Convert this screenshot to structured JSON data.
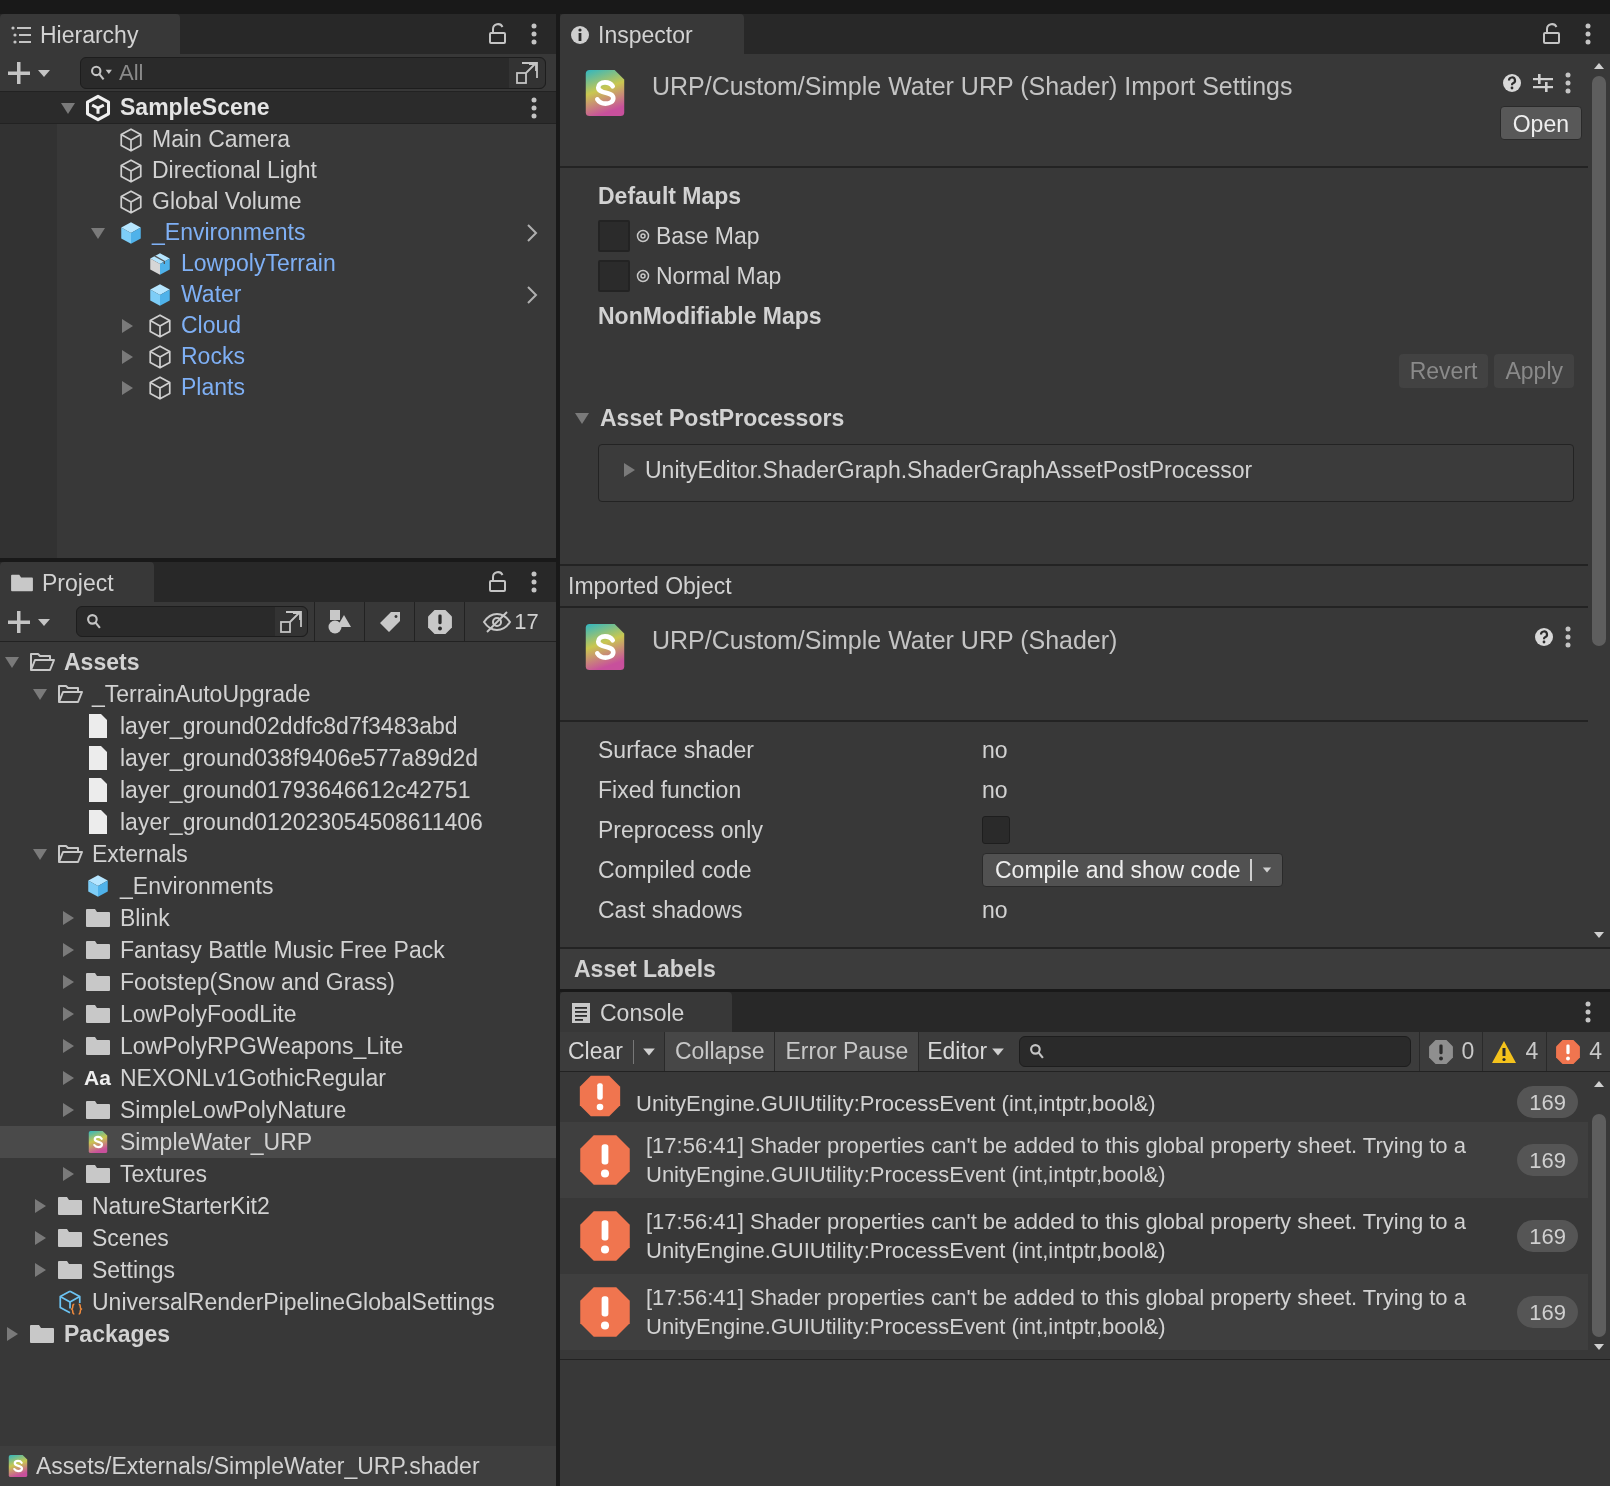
{
  "hierarchy": {
    "tab": "Hierarchy",
    "search_placeholder": "All",
    "scene": {
      "name": "SampleScene",
      "expanded": true
    },
    "items": [
      {
        "name": "Main Camera",
        "kind": "object",
        "prefab": false,
        "override_arrow": false
      },
      {
        "name": "Directional Light",
        "kind": "object",
        "prefab": false,
        "override_arrow": false
      },
      {
        "name": "Global Volume",
        "kind": "object",
        "prefab": false,
        "override_arrow": false
      },
      {
        "name": "_Environments",
        "kind": "prefab",
        "prefab": true,
        "override_arrow": true,
        "expanded": true,
        "children": [
          {
            "name": "LowpolyTerrain",
            "kind": "model",
            "prefab": true,
            "override_arrow": false
          },
          {
            "name": "Water",
            "kind": "prefab",
            "prefab": true,
            "override_arrow": true
          },
          {
            "name": "Cloud",
            "kind": "object",
            "prefab": true,
            "override_arrow": false,
            "expanded": false
          },
          {
            "name": "Rocks",
            "kind": "object",
            "prefab": true,
            "override_arrow": false,
            "expanded": false
          },
          {
            "name": "Plants",
            "kind": "object",
            "prefab": true,
            "override_arrow": false,
            "expanded": false
          }
        ]
      }
    ]
  },
  "project": {
    "tab": "Project",
    "hidden_count": "17",
    "items": [
      {
        "name": "Assets",
        "kind": "folder",
        "expanded": true,
        "selected": false,
        "children": [
          {
            "name": "_TerrainAutoUpgrade",
            "kind": "folder",
            "expanded": true,
            "selected": false,
            "children": [
              {
                "name": "layer_ground02ddfc8d7f3483abd",
                "kind": "file",
                "selected": false
              },
              {
                "name": "layer_ground038f9406e577a89d2d",
                "kind": "file",
                "selected": false
              },
              {
                "name": "layer_ground01793646612c42751",
                "kind": "file",
                "selected": false
              },
              {
                "name": "layer_ground012023054508611406",
                "kind": "file",
                "selected": false
              }
            ]
          },
          {
            "name": "Externals",
            "kind": "folder",
            "expanded": true,
            "selected": false,
            "children": [
              {
                "name": "_Environments",
                "kind": "prefab",
                "selected": false
              },
              {
                "name": "Blink",
                "kind": "folder",
                "expanded": false,
                "selected": false
              },
              {
                "name": "Fantasy Battle Music Free Pack",
                "kind": "folder",
                "expanded": false,
                "selected": false
              },
              {
                "name": "Footstep(Snow and Grass)",
                "kind": "folder",
                "expanded": false,
                "selected": false
              },
              {
                "name": "LowPolyFoodLite",
                "kind": "folder",
                "expanded": false,
                "selected": false
              },
              {
                "name": "LowPolyRPGWeapons_Lite",
                "kind": "folder",
                "expanded": false,
                "selected": false
              },
              {
                "name": "NEXONLv1GothicRegular",
                "kind": "font",
                "icon_text": "Aa",
                "expanded": false,
                "selected": false
              },
              {
                "name": "SimpleLowPolyNature",
                "kind": "folder",
                "expanded": false,
                "selected": false
              },
              {
                "name": "SimpleWater_URP",
                "kind": "shader",
                "selected": true
              },
              {
                "name": "Textures",
                "kind": "folder",
                "expanded": false,
                "selected": false
              }
            ]
          },
          {
            "name": "NatureStarterKit2",
            "kind": "folder",
            "expanded": false,
            "selected": false
          },
          {
            "name": "Scenes",
            "kind": "folder",
            "expanded": false,
            "selected": false
          },
          {
            "name": "Settings",
            "kind": "folder",
            "expanded": false,
            "selected": false
          },
          {
            "name": "UniversalRenderPipelineGlobalSettings",
            "kind": "settings",
            "selected": false
          }
        ]
      },
      {
        "name": "Packages",
        "kind": "folder",
        "expanded": false,
        "selected": false
      }
    ],
    "status_path": "Assets/Externals/SimpleWater_URP.shader"
  },
  "inspector": {
    "tab": "Inspector",
    "title": "URP/Custom/Simple Water URP (Shader) Import Settings",
    "open_button": "Open",
    "default_maps_heading": "Default Maps",
    "maps": [
      {
        "name": "Base Map"
      },
      {
        "name": "Normal Map"
      }
    ],
    "nonmodifiable_heading": "NonModifiable Maps",
    "revert_button": {
      "label": "Revert",
      "disabled": true
    },
    "apply_button": {
      "label": "Apply",
      "disabled": true
    },
    "postprocessors": {
      "heading": "Asset PostProcessors",
      "expanded": true,
      "items": [
        {
          "name": "UnityEditor.ShaderGraph.ShaderGraphAssetPostProcessor",
          "expanded": false
        }
      ]
    },
    "imported_heading": "Imported Object",
    "imported_title": "URP/Custom/Simple Water URP (Shader)",
    "properties": [
      {
        "label": "Surface shader",
        "kind": "text",
        "value": "no"
      },
      {
        "label": "Fixed function",
        "kind": "text",
        "value": "no"
      },
      {
        "label": "Preprocess only",
        "kind": "checkbox",
        "checked": false
      },
      {
        "label": "Compiled code",
        "kind": "dropdown",
        "value": "Compile and show code"
      },
      {
        "label": "Cast shadows",
        "kind": "text",
        "value": "no"
      }
    ],
    "asset_labels": "Asset Labels"
  },
  "console": {
    "tab": "Console",
    "buttons": [
      {
        "label": "Clear",
        "kind": "split"
      },
      {
        "label": "Collapse",
        "kind": "toggle"
      },
      {
        "label": "Error Pause",
        "kind": "toggle"
      },
      {
        "label": "Editor",
        "kind": "dropdown"
      }
    ],
    "counts": [
      {
        "kind": "info",
        "count": "0"
      },
      {
        "kind": "warning",
        "count": "4"
      },
      {
        "kind": "error",
        "count": "4"
      }
    ],
    "messages": [
      {
        "lines": [
          "UnityEngine.GUIUtility:ProcessEvent (int,intptr,bool&)"
        ],
        "count": "169"
      },
      {
        "lines": [
          "[17:56:41] Shader properties can't be added to this global property sheet. Trying to a",
          "UnityEngine.GUIUtility:ProcessEvent (int,intptr,bool&)"
        ],
        "count": "169"
      },
      {
        "lines": [
          "[17:56:41] Shader properties can't be added to this global property sheet. Trying to a",
          "UnityEngine.GUIUtility:ProcessEvent (int,intptr,bool&)"
        ],
        "count": "169"
      },
      {
        "lines": [
          "[17:56:41] Shader properties can't be added to this global property sheet. Trying to a",
          "UnityEngine.GUIUtility:ProcessEvent (int,intptr,bool&)"
        ],
        "count": "169"
      }
    ]
  }
}
